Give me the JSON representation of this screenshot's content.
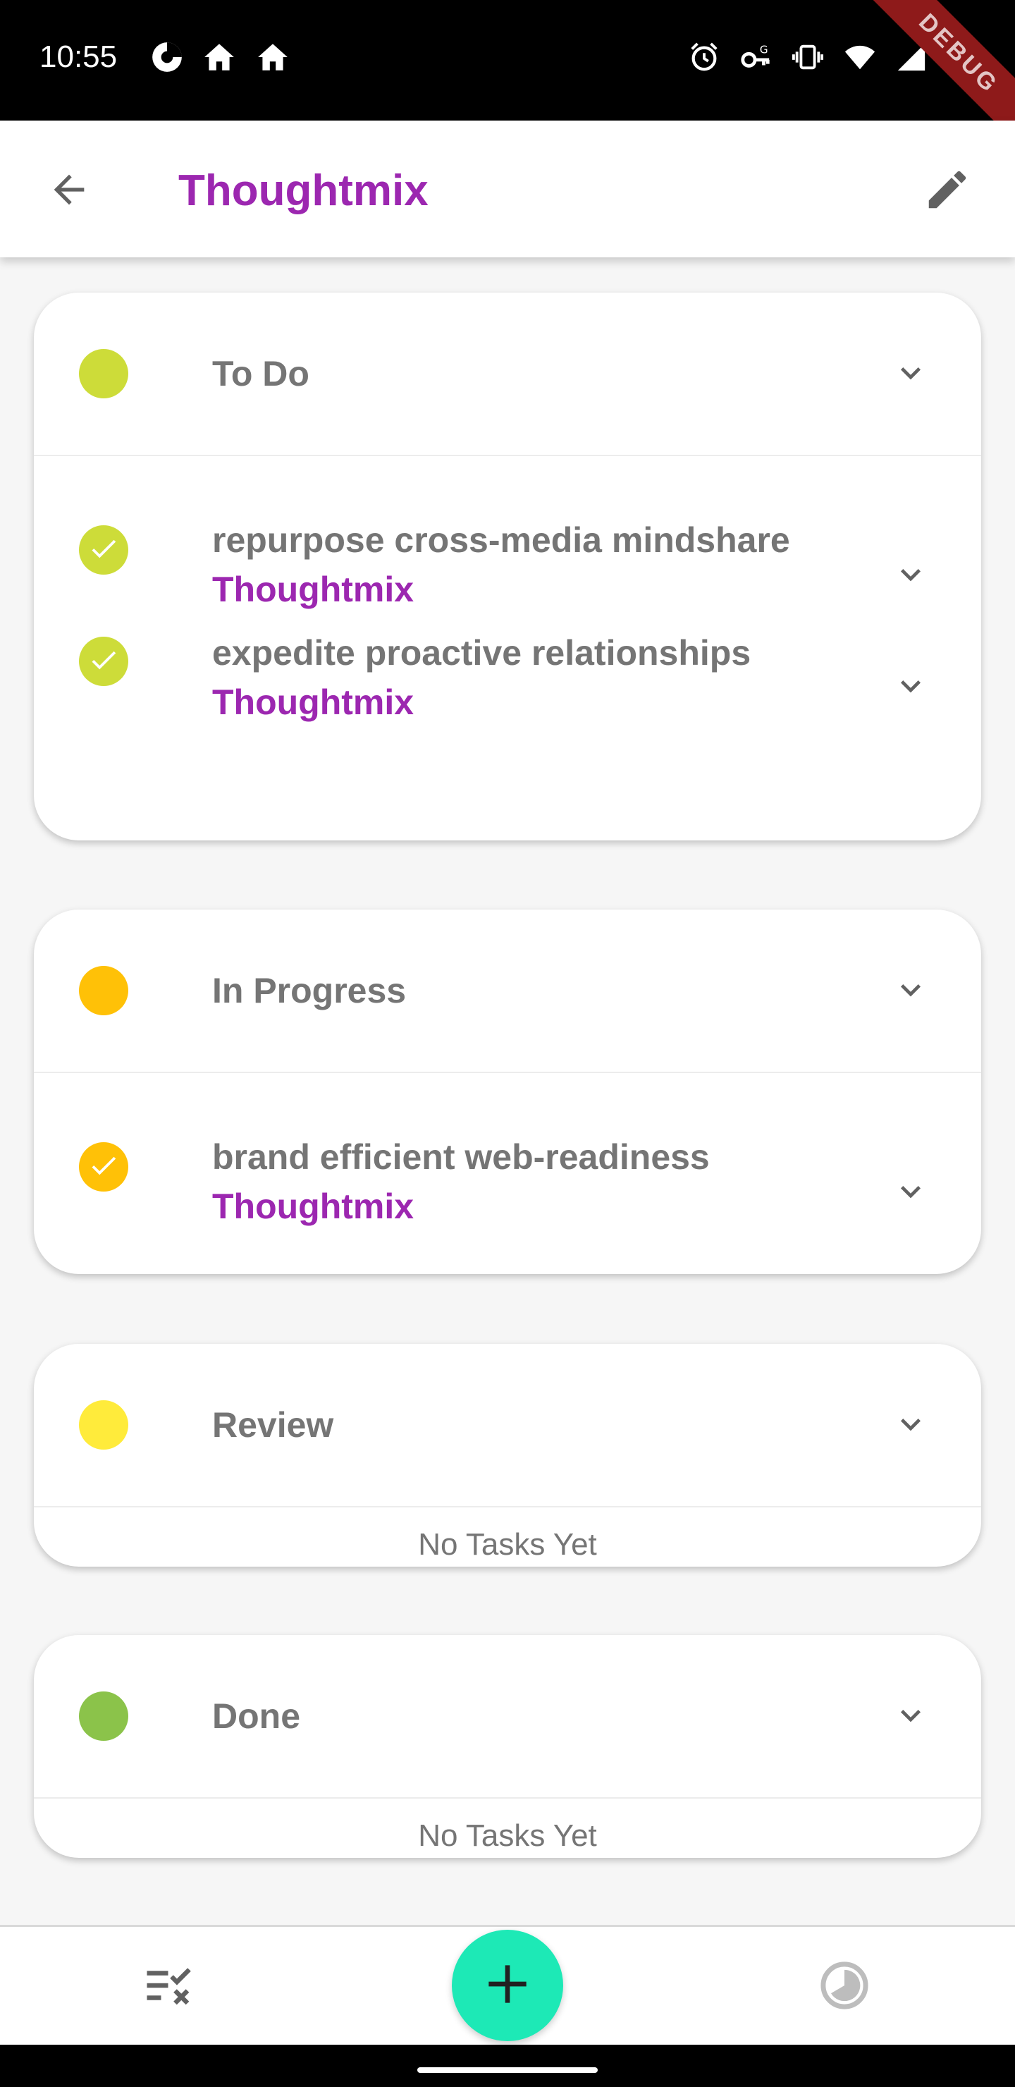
{
  "status_bar": {
    "time": "10:55",
    "left_icons": [
      "data-saver-icon",
      "home-icon",
      "home-icon"
    ],
    "right_icons": [
      "alarm-icon",
      "vpn-key-icon",
      "vibrate-icon",
      "wifi-icon",
      "signal-icon",
      "battery-icon"
    ],
    "debug_label": "DEBUG"
  },
  "app_bar": {
    "title": "Thoughtmix",
    "back_icon": "arrow-back-icon",
    "edit_icon": "edit-pencil-icon",
    "title_color": "#9c27b0"
  },
  "sections": [
    {
      "title": "To Do",
      "color": "#cddc39",
      "tasks": [
        {
          "title": "repurpose cross-media mindshare",
          "project": "Thoughtmix"
        },
        {
          "title": "expedite proactive relationships",
          "project": "Thoughtmix"
        }
      ]
    },
    {
      "title": "In Progress",
      "color": "#ffc107",
      "tasks": [
        {
          "title": "brand efficient web-readiness",
          "project": "Thoughtmix"
        }
      ]
    },
    {
      "title": "Review",
      "color": "#ffeb3b",
      "tasks": [],
      "empty_text": "No Tasks Yet"
    },
    {
      "title": "Done",
      "color": "#8bc34a",
      "tasks": [],
      "empty_text": "No Tasks Yet"
    }
  ],
  "bottom_nav": {
    "left_icon": "tasks-checklist-icon",
    "fab_icon": "add-icon",
    "right_icon": "stats-pie-icon",
    "fab_color": "#1de9b6"
  }
}
